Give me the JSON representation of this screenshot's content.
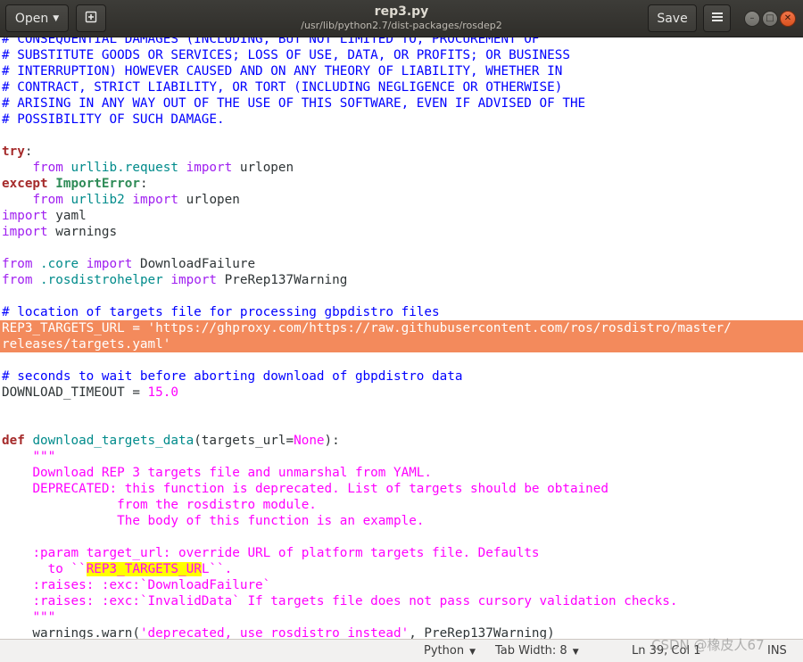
{
  "header": {
    "open_label": "Open",
    "title": "rep3.py",
    "subtitle": "/usr/lib/python2.7/dist-packages/rosdep2",
    "save_label": "Save",
    "icons": {
      "open_caret": "chevron-down-icon",
      "pin": "pin-document-icon",
      "menu": "hamburger-menu-icon",
      "minimize": "minimize-icon",
      "maximize": "maximize-icon",
      "close": "close-icon"
    },
    "colors": {
      "bar": "#3c3b37",
      "close_button": "#e95420"
    }
  },
  "editor": {
    "lines": [
      [
        {
          "t": "# CONSEQUENTIAL DAMAGES (INCLUDING, BUT NOT LIMITED TO, PROCUREMENT OF",
          "c": "comment"
        }
      ],
      [
        {
          "t": "# SUBSTITUTE GOODS OR SERVICES; LOSS OF USE, DATA, OR PROFITS; OR BUSINESS",
          "c": "comment"
        }
      ],
      [
        {
          "t": "# INTERRUPTION) HOWEVER CAUSED AND ON ANY THEORY OF LIABILITY, WHETHER IN",
          "c": "comment"
        }
      ],
      [
        {
          "t": "# CONTRACT, STRICT LIABILITY, OR TORT (INCLUDING NEGLIGENCE OR OTHERWISE)",
          "c": "comment"
        }
      ],
      [
        {
          "t": "# ARISING IN ANY WAY OUT OF THE USE OF THIS SOFTWARE, EVEN IF ADVISED OF THE",
          "c": "comment"
        }
      ],
      [
        {
          "t": "# POSSIBILITY OF SUCH DAMAGE.",
          "c": "comment"
        }
      ],
      [],
      [
        {
          "t": "try",
          "c": "kw"
        },
        {
          "t": ":"
        }
      ],
      [
        {
          "t": "    "
        },
        {
          "t": "from",
          "c": "stmt"
        },
        {
          "t": " "
        },
        {
          "t": "urllib.request",
          "c": "ident"
        },
        {
          "t": " "
        },
        {
          "t": "import",
          "c": "stmt"
        },
        {
          "t": " urlopen"
        }
      ],
      [
        {
          "t": "except",
          "c": "kw"
        },
        {
          "t": " "
        },
        {
          "t": "ImportError",
          "c": "type"
        },
        {
          "t": ":"
        }
      ],
      [
        {
          "t": "    "
        },
        {
          "t": "from",
          "c": "stmt"
        },
        {
          "t": " "
        },
        {
          "t": "urllib2",
          "c": "ident"
        },
        {
          "t": " "
        },
        {
          "t": "import",
          "c": "stmt"
        },
        {
          "t": " urlopen"
        }
      ],
      [
        {
          "t": "import",
          "c": "stmt"
        },
        {
          "t": " yaml"
        }
      ],
      [
        {
          "t": "import",
          "c": "stmt"
        },
        {
          "t": " warnings"
        }
      ],
      [],
      [
        {
          "t": "from",
          "c": "stmt"
        },
        {
          "t": " "
        },
        {
          "t": ".core",
          "c": "ident"
        },
        {
          "t": " "
        },
        {
          "t": "import",
          "c": "stmt"
        },
        {
          "t": " DownloadFailure"
        }
      ],
      [
        {
          "t": "from",
          "c": "stmt"
        },
        {
          "t": " "
        },
        {
          "t": ".rosdistrohelper",
          "c": "ident"
        },
        {
          "t": " "
        },
        {
          "t": "import",
          "c": "stmt"
        },
        {
          "t": " PreRep137Warning"
        }
      ],
      [],
      [
        {
          "t": "# location of targets file for processing gbpdistro files",
          "c": "comment"
        }
      ],
      [
        {
          "t": "REP3_TARGETS_URL = 'https://ghproxy.com/https://raw.githubusercontent.com/ros/rosdistro/master/",
          "sel": true
        }
      ],
      [
        {
          "t": "releases/targets.yaml'",
          "sel": true
        }
      ],
      [],
      [
        {
          "t": "# seconds to wait before aborting download of gbpdistro data",
          "c": "comment"
        }
      ],
      [
        {
          "t": "DOWNLOAD_TIMEOUT = "
        },
        {
          "t": "15.0",
          "c": "num"
        }
      ],
      [],
      [],
      [
        {
          "t": "def",
          "c": "kw"
        },
        {
          "t": " "
        },
        {
          "t": "download_targets_data",
          "c": "fn"
        },
        {
          "t": "(targets_url="
        },
        {
          "t": "None",
          "c": "str"
        },
        {
          "t": "):"
        }
      ],
      [
        {
          "t": "    "
        },
        {
          "t": "\"\"\"",
          "c": "str"
        }
      ],
      [
        {
          "t": "    "
        },
        {
          "t": "Download REP 3 targets file and unmarshal from YAML.",
          "c": "str"
        }
      ],
      [
        {
          "t": "    "
        },
        {
          "t": "DEPRECATED: this function is deprecated. List of targets should be obtained",
          "c": "str"
        }
      ],
      [
        {
          "t": "               "
        },
        {
          "t": "from the rosdistro module.",
          "c": "str"
        }
      ],
      [
        {
          "t": "               "
        },
        {
          "t": "The body of this function is an example.",
          "c": "str"
        }
      ],
      [],
      [
        {
          "t": "    "
        },
        {
          "t": ":param target_url: override URL of platform targets file. Defaults",
          "c": "str"
        }
      ],
      [
        {
          "t": "      "
        },
        {
          "t": "to ``",
          "c": "str"
        },
        {
          "t": "REP3_TARGETS_UR",
          "c": "str",
          "hl": true
        },
        {
          "t": "L``.",
          "c": "str"
        }
      ],
      [
        {
          "t": "    "
        },
        {
          "t": ":raises: :exc:`DownloadFailure`",
          "c": "str"
        }
      ],
      [
        {
          "t": "    "
        },
        {
          "t": ":raises: :exc:`InvalidData` If targets file does not pass cursory validation checks.",
          "c": "str"
        }
      ],
      [
        {
          "t": "    "
        },
        {
          "t": "\"\"\"",
          "c": "str"
        }
      ],
      [
        {
          "t": "    warnings.warn("
        },
        {
          "t": "'deprecated, use rosdistro instead'",
          "c": "str"
        },
        {
          "t": ", PreRep137Warning)"
        }
      ]
    ],
    "colors": {
      "selection": "#f38a5c",
      "comment": "#0000ff",
      "keyword": "#a52a2a",
      "statement": "#a020f0",
      "identifier": "#008b8b",
      "type": "#2e8b57",
      "string": "#ff00ff",
      "search_highlight": "#ffff00"
    }
  },
  "statusbar": {
    "language": "Python",
    "tab_width": "Tab Width: 8",
    "position": "Ln 39, Col 1",
    "mode": "INS",
    "dropdown_icon": "chevron-down-icon"
  },
  "watermark": "CSDN @橡皮人67"
}
